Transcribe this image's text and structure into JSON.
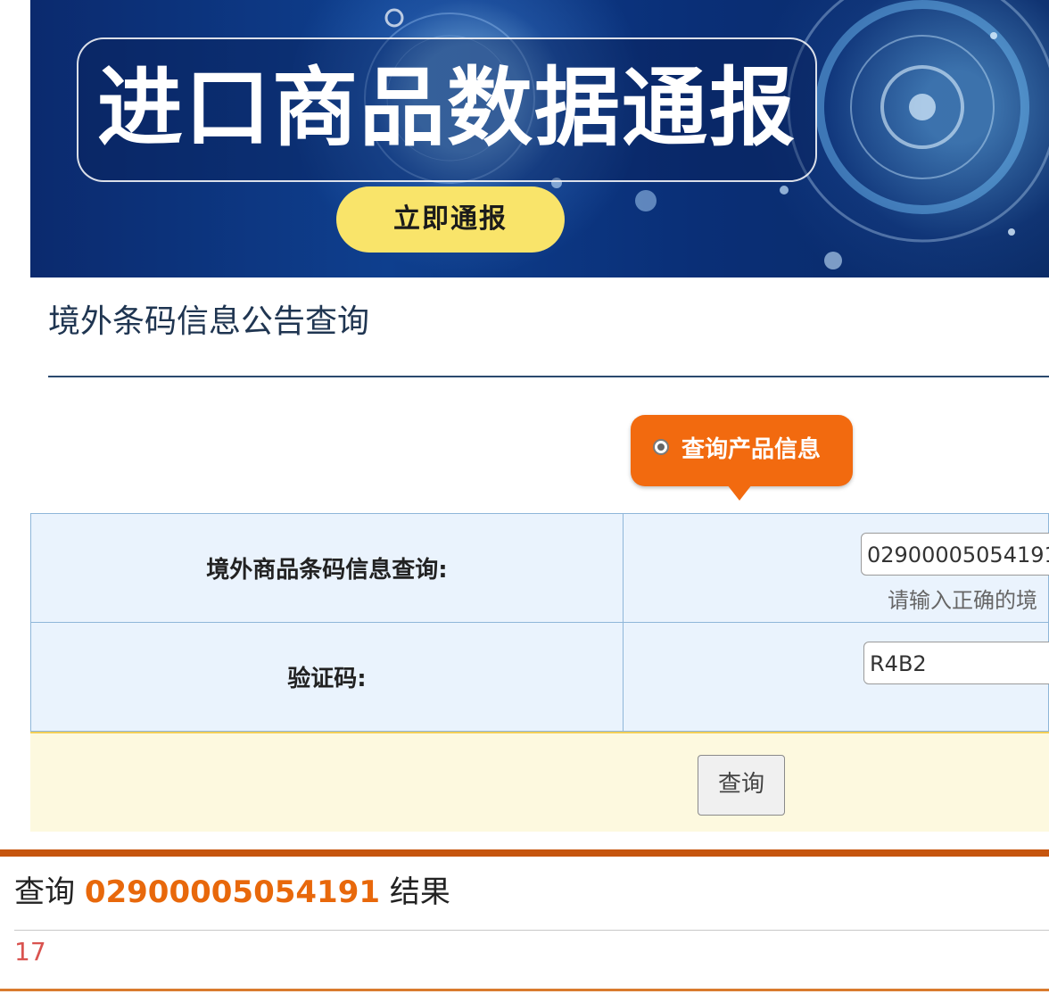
{
  "banner": {
    "title": "进口商品数据通报",
    "button_label": "立即通报"
  },
  "section": {
    "title": "境外条码信息公告查询"
  },
  "mode": {
    "label": "查询产品信息"
  },
  "form": {
    "barcode_label": "境外商品条码信息查询:",
    "barcode_value": "02900005054191",
    "barcode_hint": "请输入正确的境",
    "captcha_label": "验证码:",
    "captcha_value": "R4B2",
    "submit_label": "查询"
  },
  "result": {
    "prefix": "查询",
    "code": "02900005054191",
    "suffix": "结果",
    "count": "17"
  },
  "colors": {
    "accent_orange": "#f26a0f",
    "banner_blue": "#0b2a6e",
    "button_yellow": "#f9e46a",
    "result_red": "#d9534f"
  }
}
